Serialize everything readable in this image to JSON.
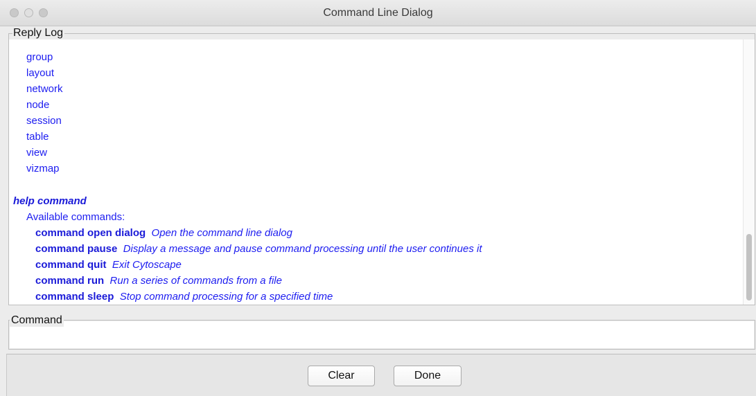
{
  "window": {
    "title": "Command Line Dialog"
  },
  "reply_log": {
    "label": "Reply Log",
    "namespaces": [
      "group",
      "layout",
      "network",
      "node",
      "session",
      "table",
      "view",
      "vizmap"
    ],
    "help_header": "help command",
    "available_label": "Available commands:",
    "commands": [
      {
        "name": "command open dialog",
        "description": "Open the command line dialog"
      },
      {
        "name": "command pause",
        "description": "Display a message and pause command processing until the user continues it"
      },
      {
        "name": "command quit",
        "description": "Exit Cytoscape"
      },
      {
        "name": "command run",
        "description": "Run a series of commands from a file"
      },
      {
        "name": "command sleep",
        "description": "Stop command processing for a specified time"
      }
    ]
  },
  "command": {
    "label": "Command",
    "value": ""
  },
  "buttons": {
    "clear": "Clear",
    "done": "Done"
  },
  "colors": {
    "log_text": "#1c1cf0",
    "window_bg": "#ececec"
  }
}
